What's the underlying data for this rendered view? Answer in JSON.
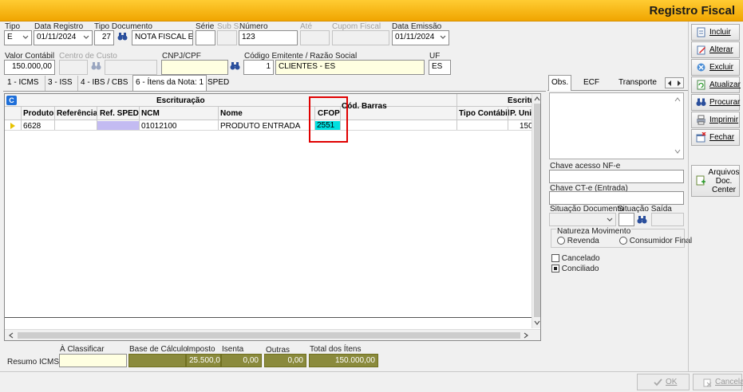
{
  "window": {
    "title": "Registro Fiscal"
  },
  "header": {
    "tipo_label": "Tipo",
    "tipo_value": "E",
    "data_registro_label": "Data Registro",
    "data_registro_value": "01/11/2024",
    "tipo_documento_label": "Tipo Documento",
    "tipo_documento_code": "27",
    "tipo_documento_name": "NOTA FISCAL ELE",
    "serie_label": "Série",
    "serie_value": "",
    "subserie_label": "Sub S.",
    "subserie_value": "",
    "numero_label": "Número",
    "numero_value": "123",
    "ate_label": "Até",
    "ate_value": "",
    "cupom_label": "Cupom Fiscal",
    "cupom_value": "",
    "data_emissao_label": "Data Emissão",
    "data_emissao_value": "01/11/2024",
    "valor_contabil_label": "Valor Contábil",
    "valor_contabil_value": "150.000,00",
    "centro_custo_label": "Centro de Custo",
    "centro_custo_value": "",
    "cnpj_label": "CNPJ/CPF",
    "cnpj_value": "",
    "codigo_emitente_label": "Código Emitente / Razão Social",
    "codigo_emitente_value": "1",
    "razao_social_value": "CLIENTES - ES",
    "uf_label": "UF",
    "uf_value": "ES"
  },
  "tabs": [
    {
      "label": "1 - ICMS"
    },
    {
      "label": "3 - ISS"
    },
    {
      "label": "4 - IBS / CBS"
    },
    {
      "label": "6 - Ítens da Nota: 1"
    },
    {
      "label": "SPED"
    }
  ],
  "grid": {
    "group_escrituracao": "Escrituração",
    "group_escrituracao2": "Escritu",
    "columns": [
      "Produto",
      "Referência",
      "Ref. SPED",
      "NCM",
      "Nome",
      "CFOP",
      "Cód. Barras",
      "Tipo Contábil",
      "P. Uni"
    ],
    "rows": [
      {
        "produto": "6628",
        "referencia": "",
        "ref_sped": "",
        "ncm": "01012100",
        "nome": "PRODUTO ENTRADA",
        "cfop": "2551",
        "cod_barras": "",
        "tipo_contabil": "",
        "p_uni": "150"
      }
    ],
    "highlight_color": "#e00000"
  },
  "resumo": {
    "label": "Resumo ICMS:",
    "a_classificar_label": "À Classificar",
    "a_classificar_value": "",
    "base_calculo_label": "Base de Cálculo",
    "base_calculo_value": "",
    "imposto_label": "Imposto",
    "imposto_value": "25.500,00",
    "isenta_label": "Isenta",
    "isenta_value": "0,00",
    "outras_label": "Outras",
    "outras_value": "0,00",
    "total_label": "Total dos Ítens",
    "total_value": "150.000,00"
  },
  "right_panel": {
    "tabs": [
      "Obs.",
      "ECF",
      "Transporte"
    ],
    "chave_nfe_label": "Chave acesso NF-e",
    "chave_nfe_value": "",
    "chave_cte_label": "Chave CT-e (Entrada)",
    "chave_cte_value": "",
    "situacao_documento_label": "Situação Documento",
    "situacao_documento_value": "",
    "situacao_saida_label": "Situação Saída",
    "situacao_saida_value": "",
    "natureza_label": "Natureza Movimento",
    "natureza_options": [
      "Revenda",
      "Consumidor Final"
    ],
    "cancelado_label": "Cancelado",
    "cancelado_checked": false,
    "conciliado_label": "Conciliado",
    "conciliado_checked": true
  },
  "side_buttons": {
    "incluir": "Incluir",
    "alterar": "Alterar",
    "excluir": "Excluir",
    "atualizar": "Atualizar",
    "procurar": "Procurar",
    "imprimir": "Imprimir",
    "fechar": "Fechar",
    "arquivos": "Arquivos Doc. Center"
  },
  "footer": {
    "ok": "OK",
    "cancela": "Cancela"
  }
}
